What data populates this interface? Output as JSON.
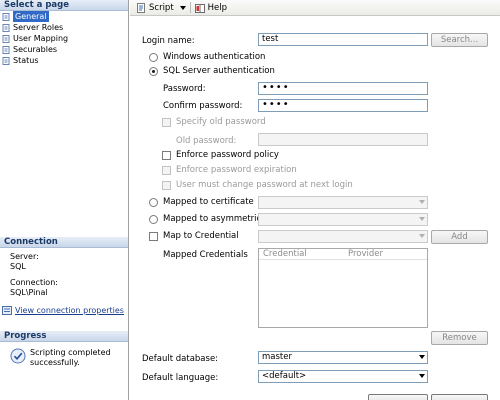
{
  "sidebar": {
    "select_page_header": "Select a page",
    "items": [
      {
        "label": "General",
        "selected": true
      },
      {
        "label": "Server Roles"
      },
      {
        "label": "User Mapping"
      },
      {
        "label": "Securables"
      },
      {
        "label": "Status"
      }
    ],
    "connection_header": "Connection",
    "server_label": "Server:",
    "server_value": "SQL",
    "connection_label": "Connection:",
    "connection_value": "SQL\\Pinal",
    "view_link": "View connection properties",
    "progress_header": "Progress",
    "progress_line1": "Scripting completed",
    "progress_line2": "successfully."
  },
  "toolbar": {
    "script_label": "Script",
    "help_label": "Help"
  },
  "form": {
    "login_name_label": "Login name:",
    "login_name_value": "test",
    "search_button": "Search...",
    "windows_auth": "Windows authentication",
    "sql_auth": "SQL Server authentication",
    "password_label": "Password:",
    "password_value": "••••",
    "confirm_label": "Confirm password:",
    "confirm_value": "••••",
    "specify_old": "Specify old password",
    "old_password_label": "Old password:",
    "enforce_policy": "Enforce password policy",
    "enforce_expiration": "Enforce password expiration",
    "must_change": "User must change password at next login",
    "mapped_cert": "Mapped to certificate",
    "mapped_asym": "Mapped to asymmetric key",
    "map_credential": "Map to Credential",
    "add_button": "Add",
    "mapped_credentials_label": "Mapped Credentials",
    "col_credential": "Credential",
    "col_provider": "Provider",
    "remove_button": "Remove",
    "default_db_label": "Default database:",
    "default_db_value": "master",
    "default_lang_label": "Default language:",
    "default_lang_value": "<default>"
  }
}
